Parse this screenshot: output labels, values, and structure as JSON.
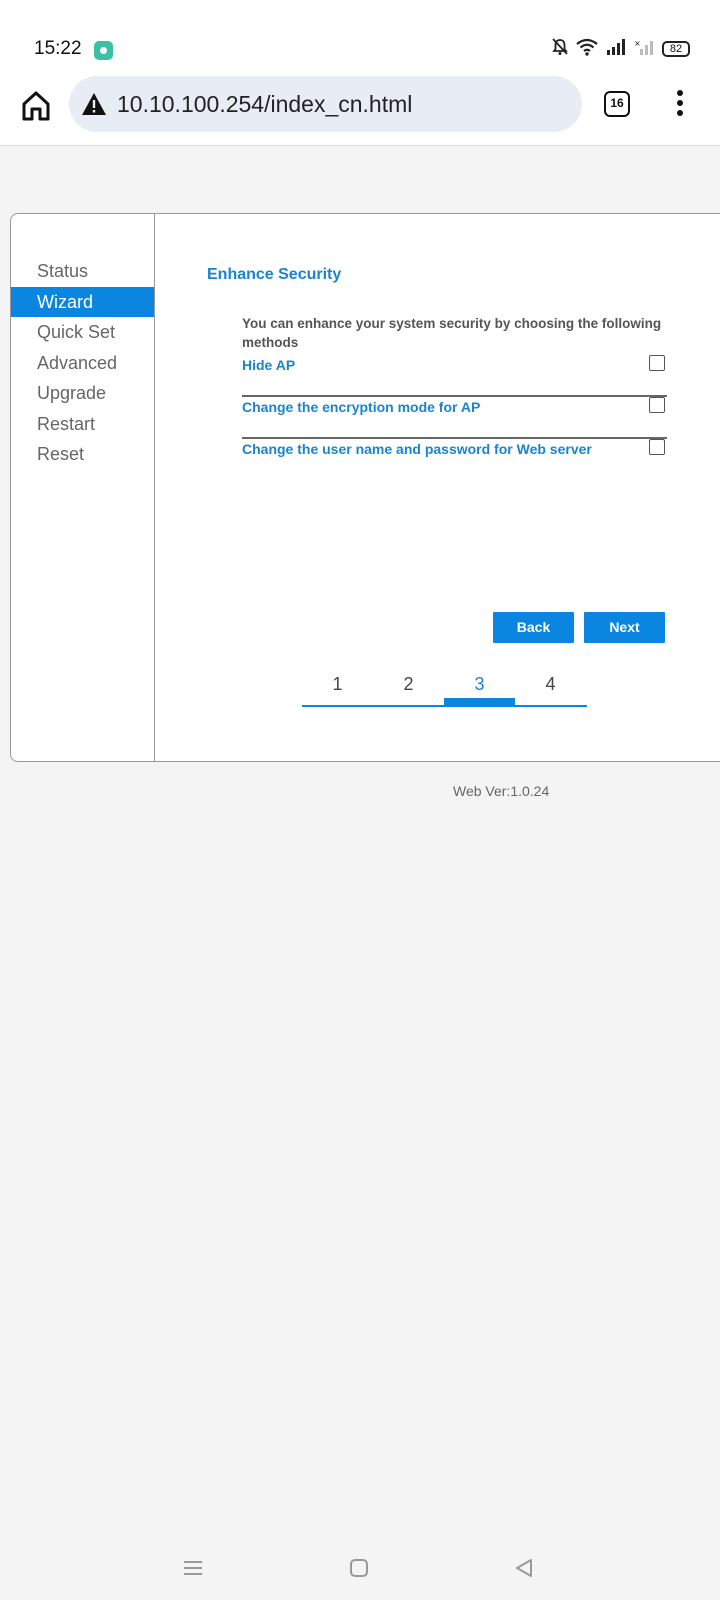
{
  "status_bar": {
    "time": "15:22",
    "battery": "82",
    "icons": [
      "app-notification-icon",
      "mute-icon",
      "wifi-icon",
      "signal-icon",
      "signal-no-service-icon",
      "battery-icon"
    ]
  },
  "browser": {
    "url": "10.10.100.254/index_cn.html",
    "tab_count": "16",
    "icons": [
      "home-icon",
      "not-secure-warning-icon",
      "tabs-icon",
      "more-menu-icon"
    ]
  },
  "sidebar": {
    "items": [
      {
        "label": "Status"
      },
      {
        "label": "Wizard"
      },
      {
        "label": "Quick Set"
      },
      {
        "label": "Advanced"
      },
      {
        "label": "Upgrade"
      },
      {
        "label": "Restart"
      },
      {
        "label": "Reset"
      }
    ],
    "active": "Wizard"
  },
  "content": {
    "title": "Enhance Security",
    "description": "You can enhance your system security by choosing the following methods",
    "options": [
      {
        "label": "Hide AP",
        "checked": false
      },
      {
        "label": "Change the encryption mode for AP",
        "checked": false
      },
      {
        "label": "Change the user name and password for Web server",
        "checked": false
      }
    ],
    "back_label": "Back",
    "next_label": "Next",
    "steps": [
      "1",
      "2",
      "3",
      "4"
    ],
    "current_step": "3"
  },
  "footer": {
    "web_version": "Web Ver:1.0.24"
  },
  "colors": {
    "accent": "#0a86e0",
    "link_text": "#1a84cf",
    "page_bg": "#f4f4f4"
  },
  "nav_bar": {
    "icons": [
      "recent-apps-icon",
      "home-nav-icon",
      "back-nav-icon"
    ]
  }
}
